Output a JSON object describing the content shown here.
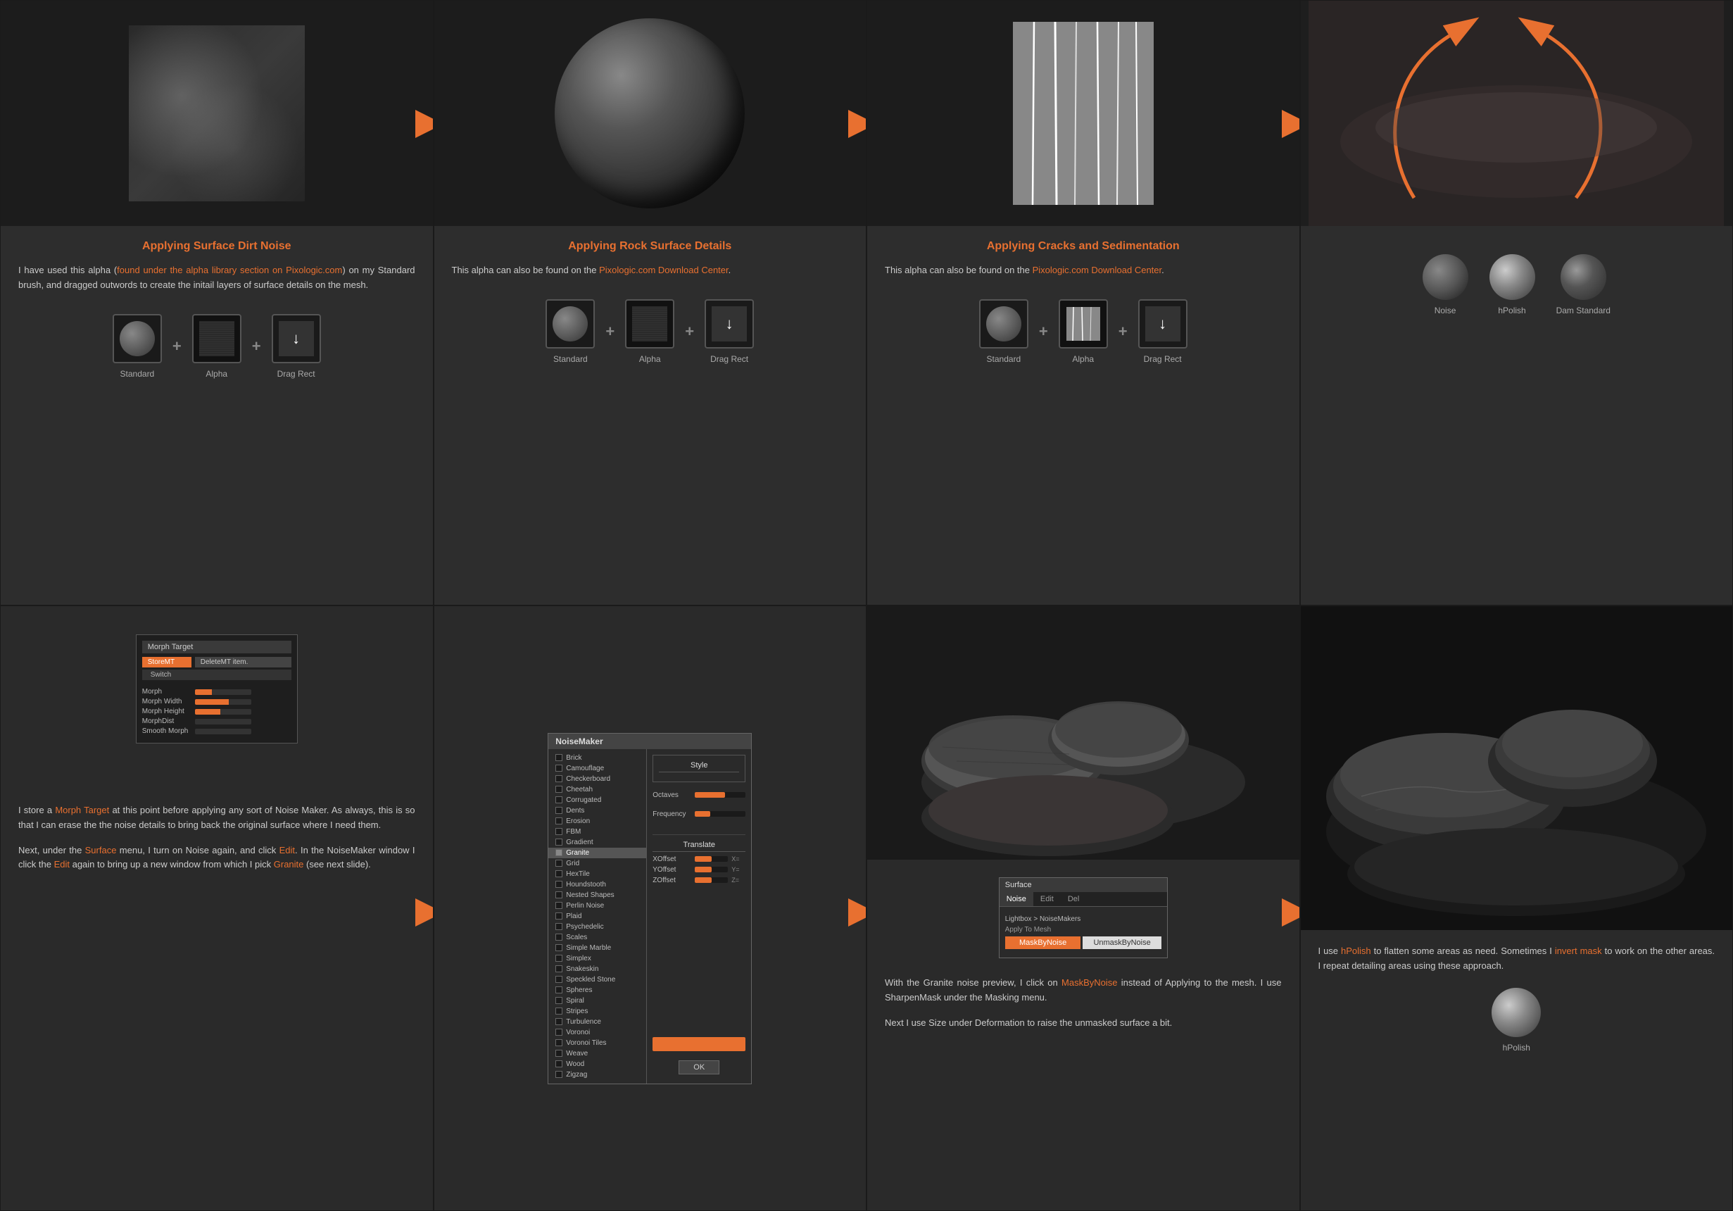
{
  "cells": {
    "top": [
      {
        "id": "top-1",
        "title": "Applying Surface Dirt Noise",
        "body": "I have used this alpha (found under the alpha library section on Pixologic.com) on my Standard brush, and dragged outwords to create the initail layers of surface details on the mesh.",
        "tools": [
          "Standard",
          "Alpha",
          "Drag Rect"
        ]
      },
      {
        "id": "top-2",
        "title": "Applying Rock Surface Details",
        "body": "This alpha can also be found on the Pixologic.com Download Center.",
        "tools": [
          "Standard",
          "Alpha",
          "Drag Rect"
        ]
      },
      {
        "id": "top-3",
        "title": "Applying Cracks and Sedimentation",
        "body": "This alpha can also be found on the Pixologic.com Download Center.",
        "tools": [
          "Standard",
          "Alpha",
          "Drag Rect"
        ]
      },
      {
        "id": "top-4",
        "title": "",
        "body": "",
        "tools": [
          "Noise",
          "hPolish",
          "Dam Standard"
        ]
      }
    ],
    "bottom": [
      {
        "id": "bottom-1",
        "title": "",
        "body1": "I store a Morph Target at this point before applying any sort of Noise Maker. As always, this is so that I can erase the the noise details to bring back the original surface where I need them.",
        "body2": "Next, under the Surface menu, I turn on Noise again, and click Edit. In the NoiseMaker window I click the Edit again to bring up a new window from which I pick Granite (see next slide).",
        "orange_words": [
          "Morph Target",
          "Surface",
          "Edit",
          "Edit",
          "Granite"
        ]
      },
      {
        "id": "bottom-2",
        "panel_title": "NoiseMaker",
        "noise_types": [
          "Brick",
          "Camouflage",
          "Checkerboard",
          "Cheetah",
          "Corrugated",
          "Dents",
          "Erosion",
          "FBM",
          "Gradient",
          "Granite",
          "Grid",
          "HexTile",
          "Houndstooth",
          "Nested Shapes",
          "Perlin Noise",
          "Plaid",
          "Psychedelic",
          "Scales",
          "Simple Marble",
          "Simplex",
          "Snakeskin",
          "Speckled Stone",
          "Spheres",
          "Spiral",
          "Stripes",
          "Turbulence",
          "Voronoi",
          "Voronoi Tiles",
          "Weave",
          "Wood",
          "Zigzag"
        ],
        "selected_item": "Granite",
        "style_label": "Style",
        "octaves_label": "Octaves",
        "frequency_label": "Frequency",
        "translate_label": "Translate",
        "xoffset_label": "XOffset",
        "yoffset_label": "YOffset",
        "zoffset_label": "ZOffset",
        "ok_label": "OK"
      },
      {
        "id": "bottom-3",
        "panel_title": "Surface",
        "tabs": [
          "Noise",
          "Edit",
          "Del"
        ],
        "lightbox_label": "Lightbox > NoiseMakers",
        "apply_label": "Apply",
        "maskbynoise_label": "MaskByNoise",
        "unmaskbynoise_label": "UnmaskByNoise",
        "body1": "With the Granite noise preview, I click on MaskByNoise instead of Applying to the mesh. I use SharpenMask under the Masking menu.",
        "body2": "Next I use Size under Deformation to raise the unmasked surface a bit.",
        "orange_words": [
          "MaskByNoise"
        ]
      },
      {
        "id": "bottom-4",
        "body": "I use hPolish to flatten some areas as need. Sometimes I invert mask to work on the other areas. I repeat detailing areas using these approach.",
        "tool_label": "hPolish",
        "orange_words": [
          "hPolish",
          "invert mask"
        ]
      }
    ]
  }
}
